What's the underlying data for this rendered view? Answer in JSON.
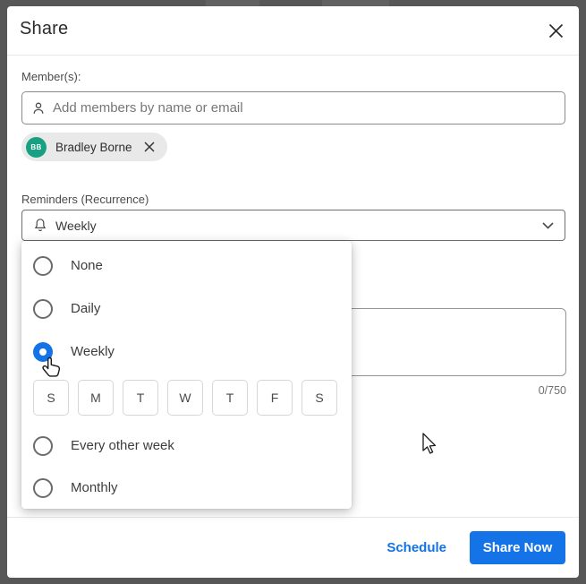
{
  "dialog": {
    "title": "Share"
  },
  "members": {
    "label": "Member(s):",
    "placeholder": "Add members by name or email",
    "chip": {
      "initials": "BB",
      "name": "Bradley Borne",
      "avatar_color": "#17A081"
    }
  },
  "reminders": {
    "label": "Reminders (Recurrence)",
    "selected_value": "Weekly",
    "options": [
      {
        "label": "None",
        "selected": false
      },
      {
        "label": "Daily",
        "selected": false
      },
      {
        "label": "Weekly",
        "selected": true
      },
      {
        "label": "Every other week",
        "selected": false
      },
      {
        "label": "Monthly",
        "selected": false
      }
    ],
    "days": [
      "S",
      "M",
      "T",
      "W",
      "T",
      "F",
      "S"
    ]
  },
  "message": {
    "char_count": "0/750",
    "value": ""
  },
  "footer": {
    "schedule_label": "Schedule",
    "share_now_label": "Share Now"
  },
  "colors": {
    "accent": "#1473E6",
    "link": "#1373E6",
    "avatar_green": "#17A081",
    "overlay": "#575757"
  }
}
